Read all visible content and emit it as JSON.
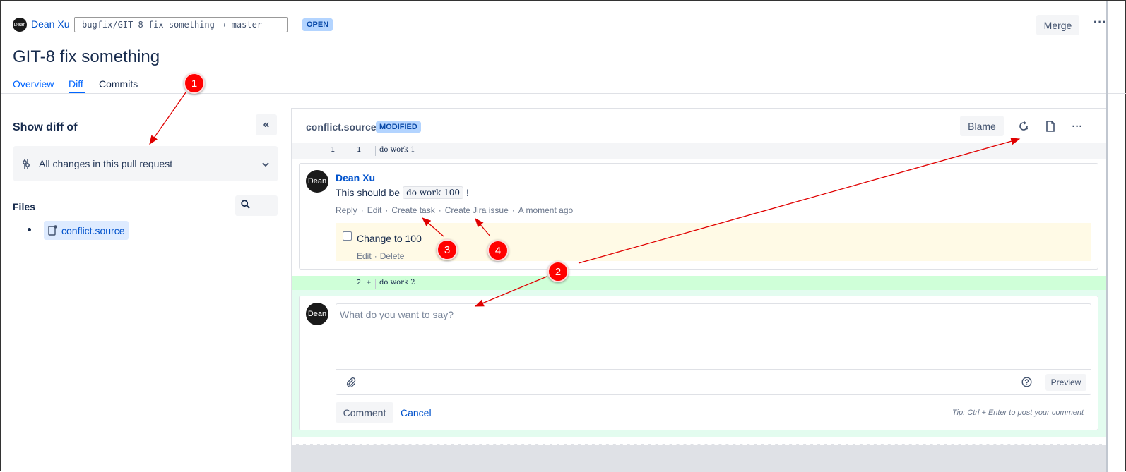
{
  "header": {
    "avatar_initials": "Dean",
    "author": "Dean Xu",
    "source_branch": "bugfix/GIT-8-fix-something",
    "arrow": "→",
    "target_branch": "master",
    "status": "OPEN",
    "merge_label": "Merge",
    "more_label": "···"
  },
  "page_title": "GIT-8 fix something",
  "tabs": [
    {
      "label": "Overview",
      "active": false
    },
    {
      "label": "Diff",
      "active": true
    },
    {
      "label": "Commits",
      "active": false
    }
  ],
  "sidebar": {
    "show_diff_label": "Show diff of",
    "collapse_icon": "«",
    "diff_option": "All changes in this pull request",
    "files_label": "Files",
    "files": [
      "conflict.source"
    ]
  },
  "diff": {
    "file_name": "conflict.source",
    "file_status": "MODIFIED",
    "blame_label": "Blame",
    "more_label": "···",
    "lines": [
      {
        "old": "1",
        "new": "1",
        "marker": "",
        "code": "do work 1"
      },
      {
        "old": "",
        "new": "2",
        "marker": "+",
        "code": "do work 2"
      }
    ]
  },
  "comment": {
    "avatar_initials": "Dean",
    "author": "Dean Xu",
    "body_prefix": "This should be",
    "body_code": "do work 100",
    "body_suffix": "!",
    "actions": [
      "Reply",
      "Edit",
      "Create task",
      "Create Jira issue",
      "A moment ago"
    ],
    "separator": "·",
    "task": {
      "label": "Change to 100",
      "checked": false,
      "actions": [
        "Edit",
        "Delete"
      ]
    }
  },
  "reply": {
    "avatar_initials": "Dean",
    "placeholder": "What do you want to say?",
    "preview_label": "Preview",
    "comment_label": "Comment",
    "cancel_label": "Cancel",
    "tip": "Tip: Ctrl + Enter to post your comment"
  },
  "annotations": [
    "1",
    "2",
    "3",
    "4"
  ],
  "colors": {
    "link": "#0052cc",
    "badge_bg": "#b3d4ff",
    "added_bg": "#e3fcef",
    "task_bg": "#fffae6",
    "callout": "#ff0000"
  }
}
